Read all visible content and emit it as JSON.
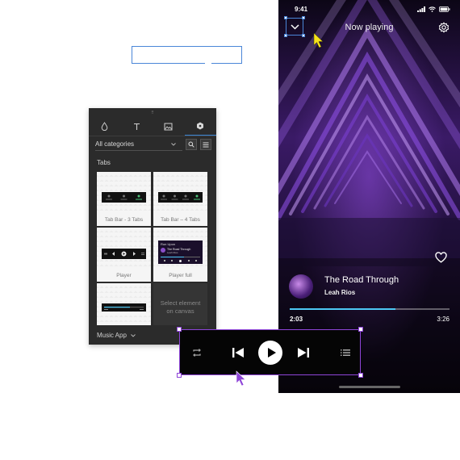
{
  "panel": {
    "grip": "⠿",
    "tabs": [
      {
        "icon": "droplet-icon"
      },
      {
        "icon": "text-icon"
      },
      {
        "icon": "image-icon"
      },
      {
        "icon": "components-icon",
        "active": true
      }
    ],
    "category_select": "All categories",
    "section_title": "Tabs",
    "cards": [
      {
        "label": "Tab Bar - 3 Tabs"
      },
      {
        "label": "Tab Bar – 4 Tabs"
      },
      {
        "label": "Player"
      },
      {
        "label": "Player full"
      },
      {
        "label": ""
      }
    ],
    "placeholder_text": "Select element on canvas",
    "footer_label": "Music App",
    "thumb_player_full": {
      "title": "Run Upon",
      "subtitle": "The Road Through",
      "artist": "Leah Rios"
    }
  },
  "phone": {
    "status_time": "9:41",
    "header_title": "Now playing",
    "song_title": "The Road Through",
    "song_artist": "Leah Rios",
    "elapsed": "2:03",
    "total": "3:26",
    "progress": 0.66,
    "accent": "#4dc8f4"
  },
  "player_bar": {
    "buttons": [
      "repeat-icon",
      "previous-icon",
      "play-icon",
      "next-icon",
      "queue-icon"
    ],
    "selection_color": "#8e44d8"
  },
  "colors": {
    "selection_blue": "#4a86d8",
    "cursor_yellow": "#f5e21a",
    "cursor_purple": "#8e44d8"
  }
}
